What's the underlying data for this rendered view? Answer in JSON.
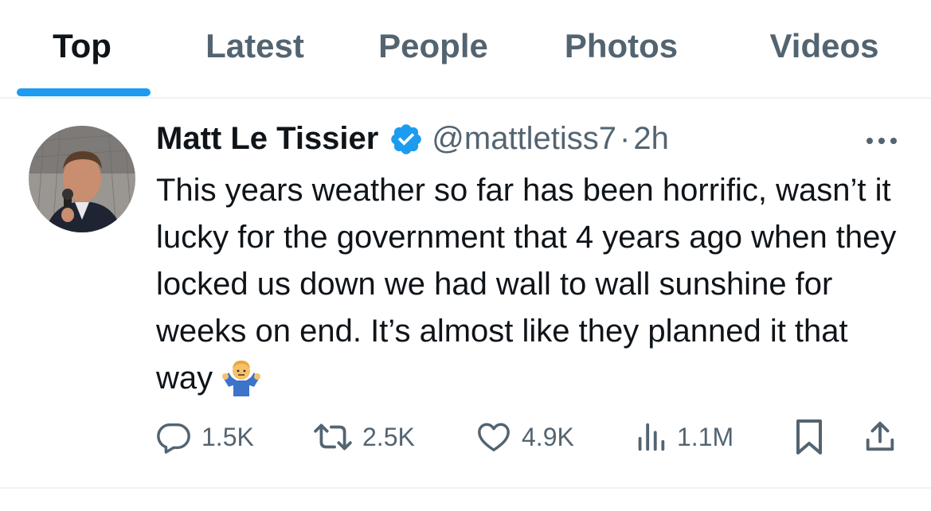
{
  "tabs": [
    {
      "label": "Top",
      "active": true
    },
    {
      "label": "Latest",
      "active": false
    },
    {
      "label": "People",
      "active": false
    },
    {
      "label": "Photos",
      "active": false
    },
    {
      "label": "Videos",
      "active": false
    }
  ],
  "colors": {
    "accent": "#1d9bf0",
    "text_primary": "#0f1419",
    "text_secondary": "#536471",
    "divider": "#eff3f4"
  },
  "tweet": {
    "author_name": "Matt Le Tissier",
    "verified": true,
    "handle": "@mattletiss7",
    "separator": "·",
    "time": "2h",
    "text": "This years weather so far has been horrific, wasn’t it lucky for the government that 4 years ago when they locked us down we had wall to wall sunshine for weeks on end. It’s almost like they planned it that way",
    "emoji": "man-shrugging-emoji",
    "more_icon": "more-icon",
    "actions": {
      "replies": "1.5K",
      "reposts": "2.5K",
      "likes": "4.9K",
      "views": "1.1M"
    },
    "icons": [
      "reply-icon",
      "repost-icon",
      "like-icon",
      "views-icon",
      "bookmark-icon",
      "share-icon"
    ]
  }
}
